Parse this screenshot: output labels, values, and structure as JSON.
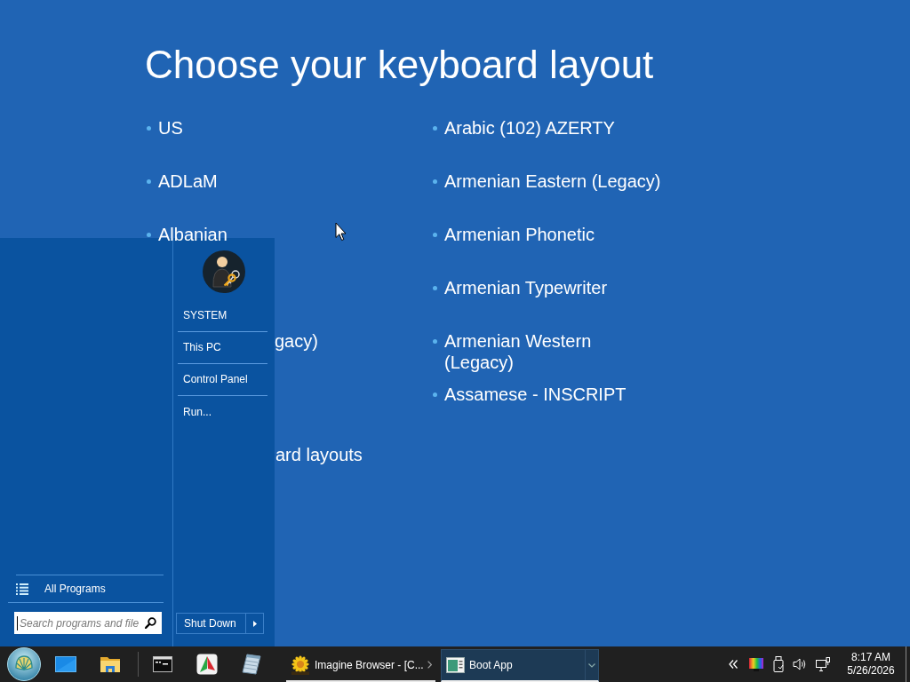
{
  "screen": {
    "title": "Choose your keyboard layout",
    "left_column": [
      {
        "label": "US"
      },
      {
        "label": "ADLaM"
      },
      {
        "label": "Albanian"
      }
    ],
    "right_column": [
      {
        "label": "Arabic (102) AZERTY"
      },
      {
        "label": "Armenian Eastern (Legacy)"
      },
      {
        "label": "Armenian Phonetic"
      },
      {
        "label": "Armenian Typewriter"
      },
      {
        "label": "Armenian Western (Legacy)"
      },
      {
        "label": "Assamese - INSCRIPT"
      }
    ],
    "partly_covered": [
      {
        "label": "gacy)"
      }
    ],
    "more_link": "ard layouts"
  },
  "start_menu": {
    "places": [
      {
        "label": "SYSTEM"
      },
      {
        "label": "This PC"
      },
      {
        "label": "Control Panel"
      },
      {
        "label": "Run..."
      }
    ],
    "all_programs": "All Programs",
    "search": {
      "placeholder": "Search programs and file"
    },
    "shut_down": "Shut Down"
  },
  "taskbar": {
    "tasks": [
      {
        "label": "Imagine Browser - [C...",
        "selected": false,
        "kind": "chevron"
      },
      {
        "label": "Boot App",
        "selected": true,
        "kind": "split"
      }
    ],
    "clock": {
      "time": "8:17 AM",
      "date": "5/26/2026"
    }
  }
}
